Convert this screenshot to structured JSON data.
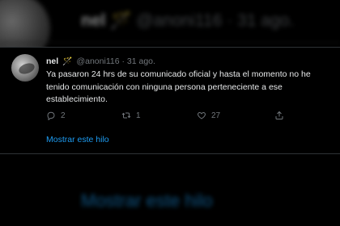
{
  "background": {
    "name": "nel",
    "handle": "@anoni116",
    "separator": "·",
    "date": "31 ago.",
    "show_thread": "Mostrar este hilo"
  },
  "tweet": {
    "name": "nel",
    "badge_icon": "magic-wand-icon",
    "handle": "@anoni116",
    "separator": "·",
    "date": "31 ago.",
    "text": "Ya pasaron 24 hrs de su comunicado oficial y hasta el momento no he tenido comunicación con ninguna persona perteneciente a ese establecimiento.",
    "actions": {
      "reply_count": "2",
      "retweet_count": "1",
      "like_count": "27"
    },
    "show_thread": "Mostrar este hilo"
  },
  "colors": {
    "background": "#000000",
    "text": "#e7e9ea",
    "muted": "#71767b",
    "link": "#1d9bf0"
  }
}
